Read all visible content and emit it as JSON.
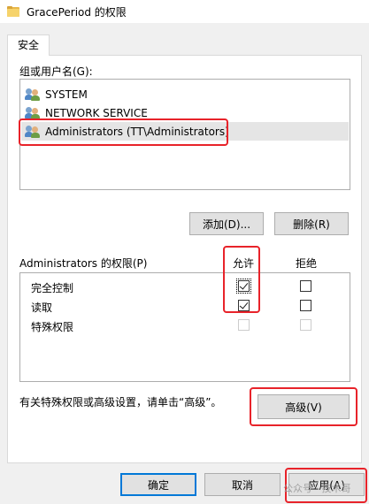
{
  "window": {
    "title": "GracePeriod 的权限",
    "icon": "folder-icon"
  },
  "tabs": [
    {
      "label": "安全",
      "active": true
    }
  ],
  "principals": {
    "label": "组或用户名(G):",
    "items": [
      {
        "label": "SYSTEM",
        "icon": "users-icon",
        "selected": false
      },
      {
        "label": "NETWORK SERVICE",
        "icon": "users-icon",
        "selected": false
      },
      {
        "label": "Administrators (TT\\Administrators)",
        "icon": "users-icon",
        "selected": true
      }
    ]
  },
  "actions": {
    "add_label": "添加(D)...",
    "remove_label": "删除(R)"
  },
  "permissions": {
    "title": "Administrators 的权限(P)",
    "allow_header": "允许",
    "deny_header": "拒绝",
    "rows": [
      {
        "label": "完全控制",
        "allow": true,
        "deny": false,
        "enabled": true
      },
      {
        "label": "读取",
        "allow": true,
        "deny": false,
        "enabled": true
      },
      {
        "label": "特殊权限",
        "allow": false,
        "deny": false,
        "enabled": false
      }
    ]
  },
  "advanced": {
    "hint": "有关特殊权限或高级设置，请单击“高级”。",
    "button_label": "高级(V)"
  },
  "footer": {
    "ok_label": "确定",
    "cancel_label": "取消",
    "apply_label": "应用(A)"
  },
  "watermark": "公众号 · 技术哥",
  "colors": {
    "annotation": "#e8232a",
    "focus_blue": "#0078d7",
    "background": "#f0f0f0"
  }
}
